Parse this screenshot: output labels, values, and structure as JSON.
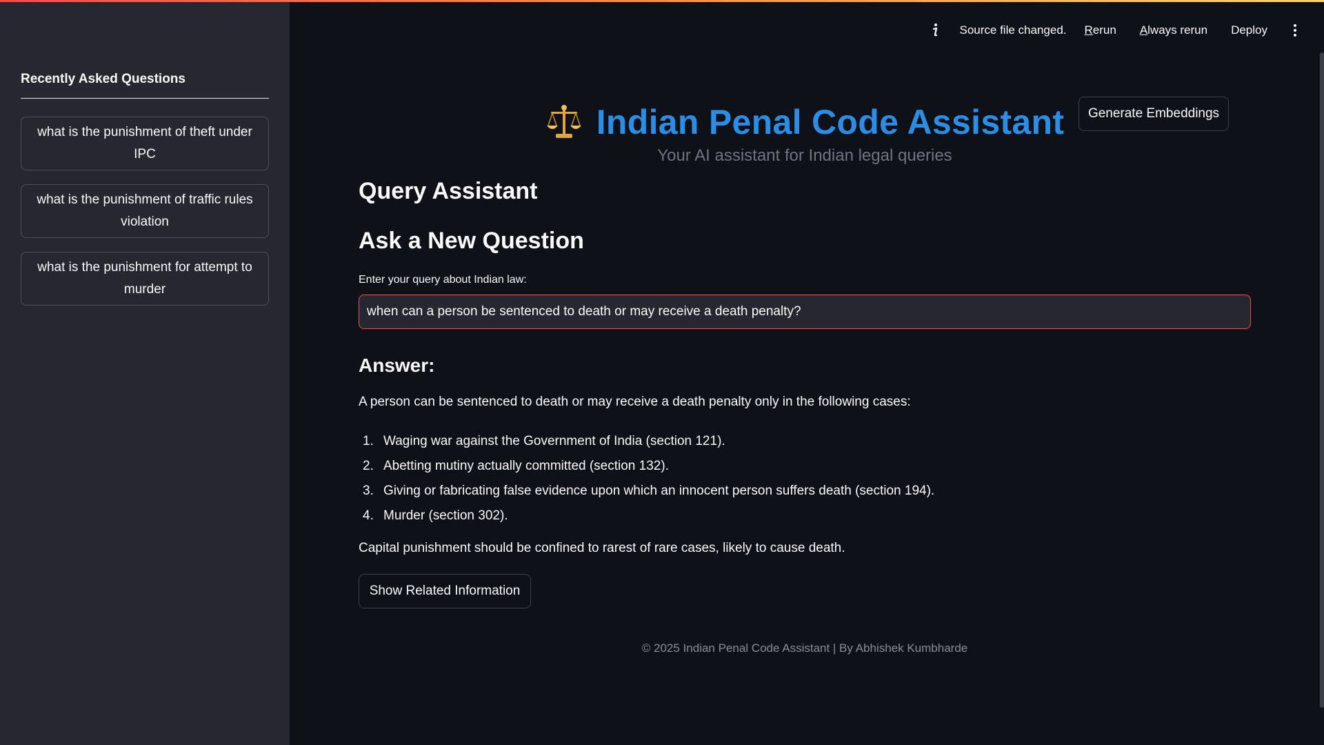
{
  "toolbar": {
    "status": "Source file changed.",
    "rerun": {
      "accel": "R",
      "rest": "erun"
    },
    "always_rerun": {
      "accel": "A",
      "rest": "lways rerun"
    },
    "deploy": "Deploy"
  },
  "sidebar": {
    "title": "Recently Asked Questions",
    "items": [
      {
        "label": "what is the punishment of theft under IPC"
      },
      {
        "label": "what is the punishment of traffic rules violation"
      },
      {
        "label": "what is the punishment for attempt to murder"
      }
    ]
  },
  "header": {
    "title": "Indian Penal Code Assistant",
    "subtitle": "Your AI assistant for Indian legal queries",
    "generate_button": "Generate Embeddings"
  },
  "main": {
    "section_title": "Query Assistant",
    "ask_title": "Ask a New Question",
    "input_label": "Enter your query about Indian law:",
    "input_value": "when can a person be sentenced to death or may receive a death penalty?",
    "answer_title": "Answer:",
    "answer_intro": "A person can be sentenced to death or may receive a death penalty only in the following cases:",
    "answer_items": [
      {
        "num": "1.",
        "text": "Waging war against the Government of India (section 121)."
      },
      {
        "num": "2.",
        "text": "Abetting mutiny actually committed (section 132)."
      },
      {
        "num": "3.",
        "text": "Giving or fabricating false evidence upon which an innocent person suffers death (section 194)."
      },
      {
        "num": "4.",
        "text": "Murder (section 302)."
      }
    ],
    "answer_closing": "Capital punishment should be confined to rarest of rare cases, likely to cause death.",
    "related_button": "Show Related Information"
  },
  "footer": {
    "text": "© 2025 Indian Penal Code Assistant | By Abhishek Kumbharde"
  },
  "colors": {
    "background": "#0e1117",
    "sidebar": "#262730",
    "accent_title": "#2c8de5",
    "input_border": "#ff4b4b"
  },
  "icons": {
    "title_icon": "balance-scale-icon",
    "info": "info-icon",
    "menu": "kebab-menu-icon"
  }
}
